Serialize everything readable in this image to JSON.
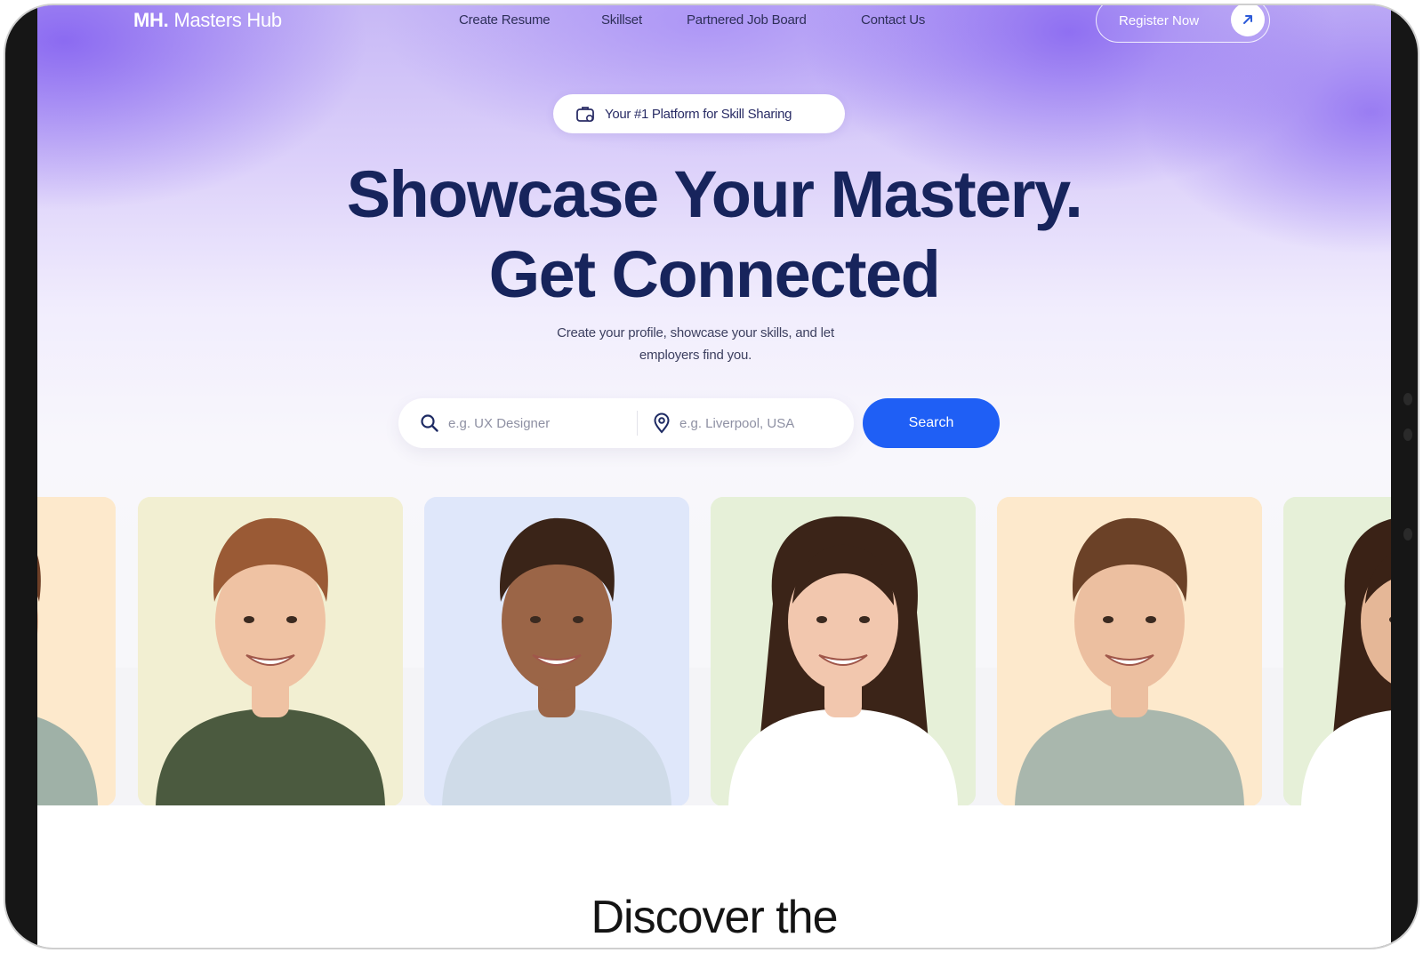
{
  "nav": {
    "logo_mark": "MH.",
    "logo_name": "Masters Hub",
    "links": [
      "Create Resume",
      "Skillset",
      "Partnered Job Board",
      "Contact Us"
    ],
    "register_label": "Register Now",
    "register_icon": "arrow-up-right-icon"
  },
  "hero": {
    "badge_icon": "briefcase-icon",
    "badge_text": "Your #1 Platform for Skill Sharing",
    "headline_line1": "Showcase Your Mastery.",
    "headline_line2": "Get Connected",
    "subtitle_line1": "Create your profile, showcase your skills, and let",
    "subtitle_line2": "employers find you."
  },
  "search": {
    "role_icon": "search-icon",
    "role_placeholder": "e.g. UX Designer",
    "location_icon": "location-pin-icon",
    "location_placeholder": "e.g. Liverpool, USA",
    "button_label": "Search"
  },
  "profiles": [
    {
      "bg": "#fde9cc",
      "shirt": "#9fb1a7",
      "skin": "#e7b592",
      "hair": "#6e3f27",
      "partial": "left"
    },
    {
      "bg": "#f2efd2",
      "shirt": "#4b5a3f",
      "skin": "#efc2a3",
      "hair": "#9a5a35"
    },
    {
      "bg": "#dfe7fa",
      "shirt": "#cfdbe8",
      "skin": "#9b6547",
      "hair": "#3a2418"
    },
    {
      "bg": "#e6f0d8",
      "shirt": "#ffffff",
      "skin": "#f2c7ae",
      "hair": "#3b2418"
    },
    {
      "bg": "#fde9cc",
      "shirt": "#a9b7ad",
      "skin": "#ecbfa0",
      "hair": "#6b4127"
    },
    {
      "bg": "#e6f0d8",
      "shirt": "#ffffff",
      "skin": "#e5b797",
      "hair": "#3a2216",
      "partial": "right"
    }
  ],
  "section": {
    "title": "Discover the"
  },
  "colors": {
    "accent": "#1f5ff5",
    "headline": "#17245c",
    "purple_glow": "#805cf0"
  }
}
